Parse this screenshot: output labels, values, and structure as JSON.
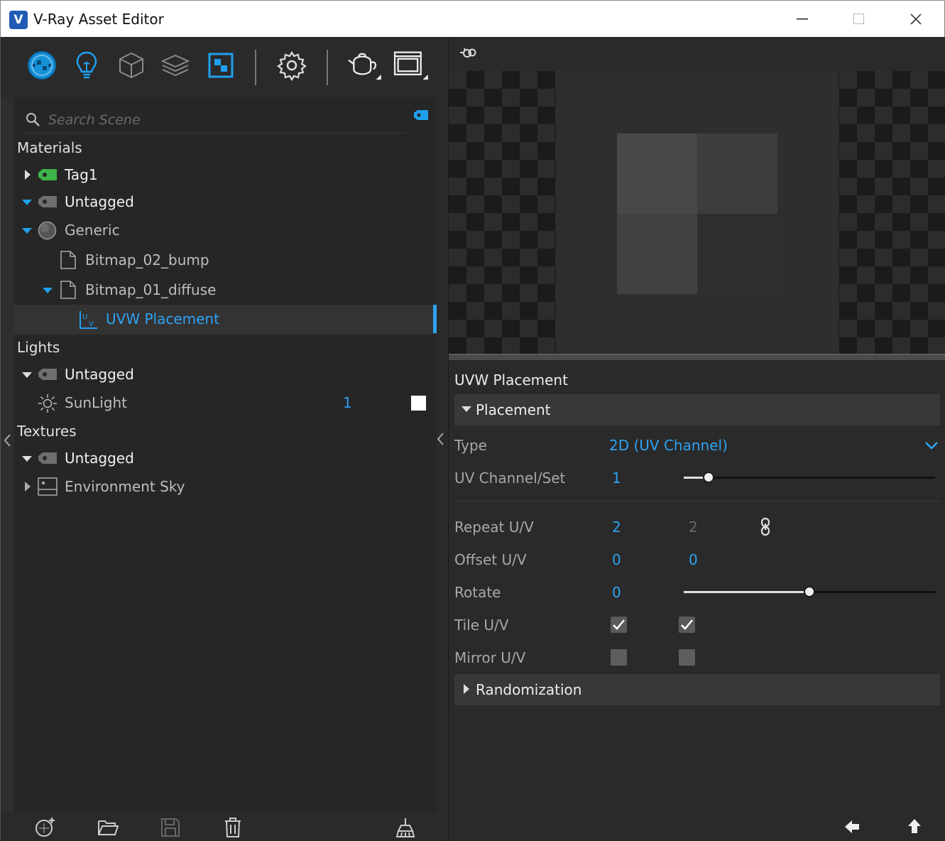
{
  "window": {
    "title": "V-Ray Asset Editor",
    "logo_glyph": "V",
    "controls": [
      "minimize-icon",
      "maximize-icon",
      "close-icon"
    ]
  },
  "toolbar": {
    "icons": [
      "materials-icon",
      "lights-icon",
      "geometry-icon",
      "render-elements-icon",
      "textures-icon",
      "settings-icon",
      "render-icon",
      "frame-buffer-icon"
    ]
  },
  "search": {
    "placeholder": "Search Scene",
    "tag_icon": "tag-filter-icon"
  },
  "tree": {
    "materials": {
      "label": "Materials",
      "items": [
        {
          "label": "Tag1",
          "expanded": false,
          "icon": "tag-icon",
          "tag_color": "#3db34a"
        },
        {
          "label": "Untagged",
          "expanded": true,
          "icon": "tag-icon",
          "tag_color": "#8a8a8a"
        },
        {
          "label": "Generic",
          "expanded": true,
          "icon": "material-sphere-icon"
        },
        {
          "label": "Bitmap_02_bump",
          "icon": "file-icon"
        },
        {
          "label": "Bitmap_01_diffuse",
          "expanded": true,
          "icon": "file-icon"
        },
        {
          "label": "UVW Placement",
          "icon": "uvw-icon",
          "selected": true
        }
      ]
    },
    "lights": {
      "label": "Lights",
      "items": [
        {
          "label": "Untagged",
          "expanded": true,
          "icon": "tag-icon"
        },
        {
          "label": "SunLight",
          "icon": "sun-icon",
          "count": "1",
          "enabled": true
        }
      ]
    },
    "textures": {
      "label": "Textures",
      "items": [
        {
          "label": "Untagged",
          "expanded": true,
          "icon": "tag-icon"
        },
        {
          "label": "Environment Sky",
          "expanded": false,
          "icon": "environment-icon"
        }
      ]
    }
  },
  "left_bottom": {
    "icons": [
      "add-asset-icon",
      "open-folder-icon",
      "save-icon",
      "delete-icon",
      "purge-icon"
    ]
  },
  "preview": {
    "icon": "preview-settings-icon"
  },
  "properties": {
    "title": "UVW Placement",
    "sections": {
      "placement": {
        "label": "Placement",
        "expanded": true
      },
      "randomization": {
        "label": "Randomization",
        "expanded": false
      }
    },
    "type": {
      "label": "Type",
      "value": "2D (UV Channel)"
    },
    "uv_channel": {
      "label": "UV Channel/Set",
      "value": "1",
      "slider": 0.1
    },
    "repeat": {
      "label": "Repeat U/V",
      "u": "2",
      "v": "2",
      "locked": true
    },
    "offset": {
      "label": "Offset U/V",
      "u": "0",
      "v": "0"
    },
    "rotate": {
      "label": "Rotate",
      "value": "0",
      "slider": 0.5
    },
    "tile": {
      "label": "Tile U/V",
      "u": true,
      "v": true
    },
    "mirror": {
      "label": "Mirror U/V",
      "u": false,
      "v": false
    }
  },
  "right_bottom": {
    "icons": [
      "back-arrow-icon",
      "up-arrow-icon"
    ]
  }
}
